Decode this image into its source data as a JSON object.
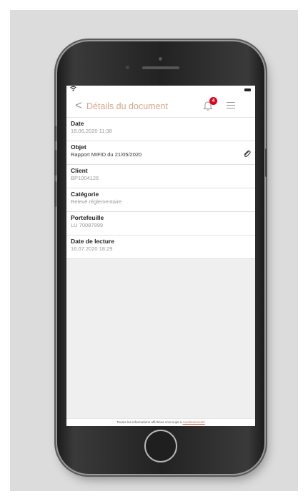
{
  "header": {
    "back_symbol": "<",
    "title": "Détails du document",
    "notification_count": "4"
  },
  "details": [
    {
      "label": "Date",
      "value": "18.06.2020 11:38",
      "dark": false
    },
    {
      "label": "Objet",
      "value": "Rapport MIFID du 21/05/2020",
      "dark": true
    },
    {
      "label": "Client",
      "value": "BP1004126",
      "dark": false
    },
    {
      "label": "Catégorie",
      "value": "Relevé réglementaire",
      "dark": false
    },
    {
      "label": "Portefeuille",
      "value": "LU 70087999",
      "dark": false
    },
    {
      "label": "Date de lecture",
      "value": "16.07.2020 18:29",
      "dark": false
    }
  ],
  "footer": {
    "text": "Toutes les informations affichées sont sujet à",
    "link": "Avertissements"
  },
  "colors": {
    "accent": "#d9a48a",
    "badge": "#e3001b"
  },
  "icons": {
    "back": "chevron-left-icon",
    "bell": "bell-icon",
    "menu": "hamburger-menu-icon",
    "attachment": "paperclip-icon",
    "wifi": "wifi-icon",
    "battery": "battery-icon"
  }
}
